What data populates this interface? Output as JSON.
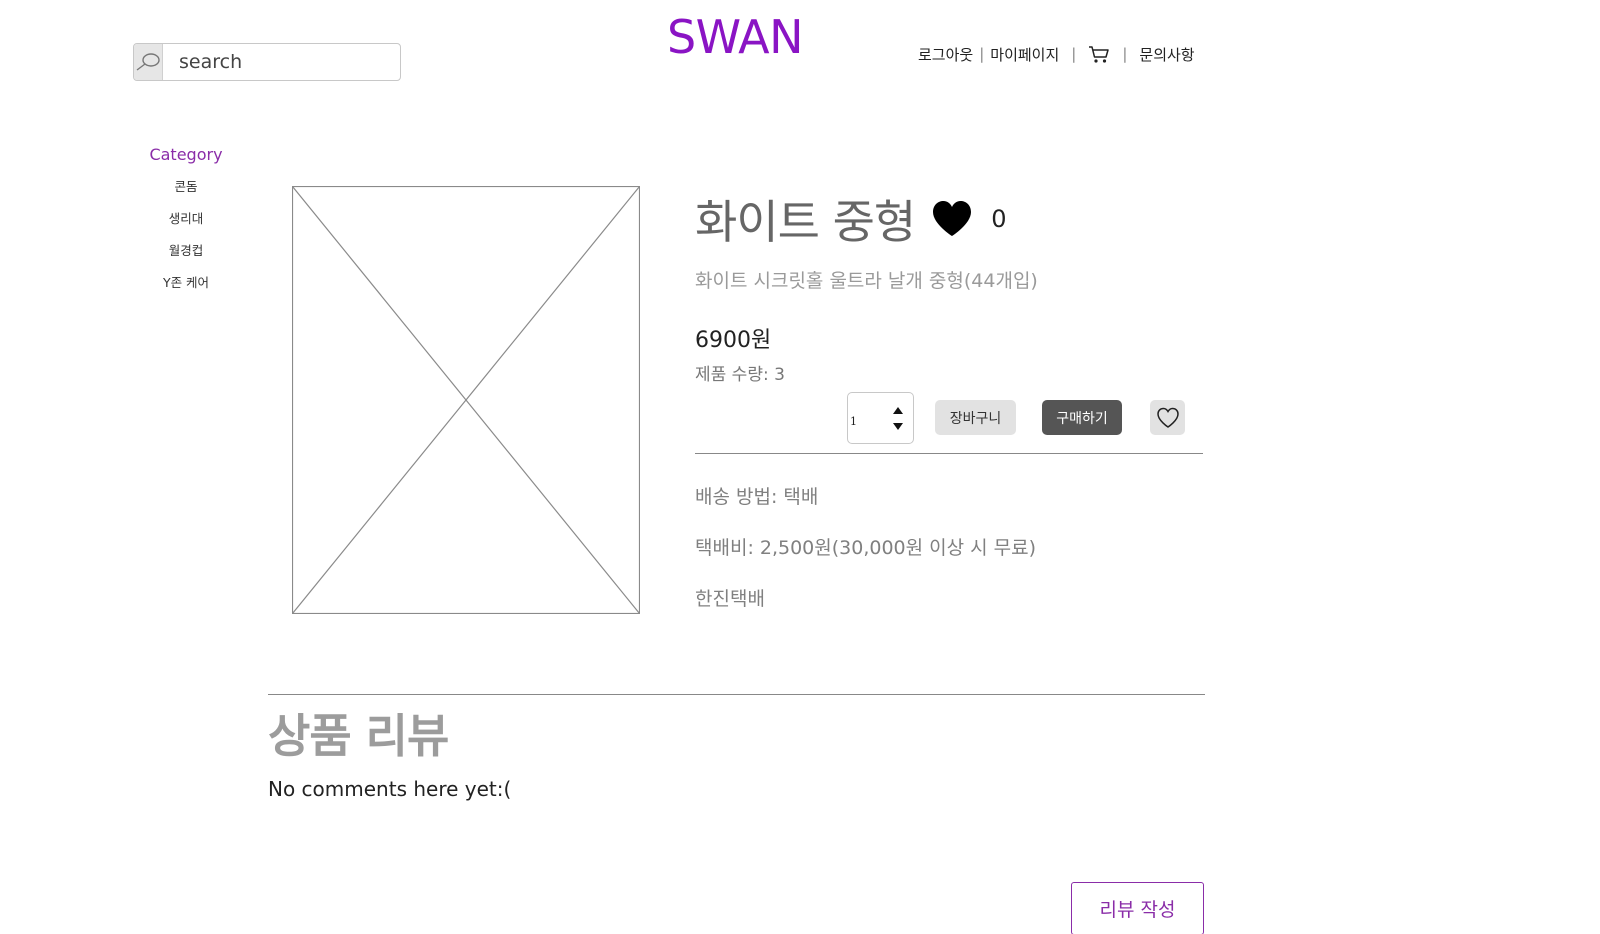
{
  "header": {
    "logo": "SWAN",
    "search": {
      "placeholder": "search",
      "value": ""
    },
    "nav": {
      "logout": "로그아웃",
      "mypage": "마이페이지",
      "inquiry": "문의사항",
      "separator": "|"
    }
  },
  "sidebar": {
    "title": "Category",
    "items": [
      {
        "label": "콘돔"
      },
      {
        "label": "생리대"
      },
      {
        "label": "월경컵"
      },
      {
        "label": "Y존 케어"
      }
    ]
  },
  "product": {
    "title": "화이트 중형",
    "likes": "0",
    "subtitle": "화이트 시크릿홀 울트라 날개 중형(44개입)",
    "price": "6900원",
    "stock": "제품 수량: 3",
    "quantity": "1",
    "cart_label": "장바구니",
    "buy_label": "구매하기",
    "shipping_method": "배송 방법: 택배",
    "shipping_fee": "택배비: 2,500원(30,000원 이상 시 무료)",
    "courier": "한진택배"
  },
  "reviews": {
    "heading": "상품 리뷰",
    "empty_text": "No comments here yet:(",
    "write_label": "리뷰 작성"
  },
  "colors": {
    "brand": "#8a14c4",
    "accent": "#8a2da8",
    "buy_button": "#555555",
    "secondary_button": "#e2e2e2"
  }
}
